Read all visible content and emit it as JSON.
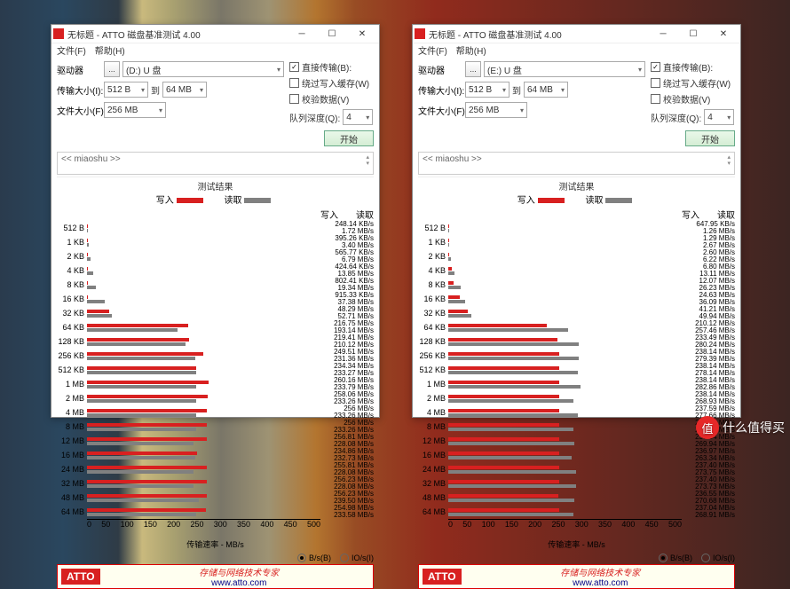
{
  "watermark": {
    "badge": "值",
    "text": "什么值得买"
  },
  "labels": {
    "title": "无标题 - ATTO 磁盘基准测试 4.00",
    "file_menu": "文件(F)",
    "help_menu": "帮助(H)",
    "drive": "驱动器",
    "xfer_size": "传输大小(I):",
    "file_size": "文件大小(F):",
    "direct": "直接传输(B):",
    "write_cache": "绕过写入缓存(W)",
    "verify": "校验数据(V)",
    "queue": "队列深度(Q):",
    "start": "开始",
    "desc_prefix": "<< miaoshu >>",
    "result_title": "测试结果",
    "write": "写入",
    "read": "读取",
    "xaxis_label": "传输速率 - MB/s",
    "bytes_per_sec": "B/s(B)",
    "io_per_sec": "IO/s(I)",
    "footer_text": "存储与网络技术专家",
    "footer_url": "www.atto.com",
    "atto": "ATTO",
    "to": "到"
  },
  "windows": [
    {
      "drive": "(D:) U 盘",
      "xfer_from": "512 B",
      "xfer_to": "64 MB",
      "file_size": "256 MB",
      "queue": "4",
      "chart_data": {
        "type": "bar",
        "xlabel": "传输速率 - MB/s",
        "xlim": [
          0,
          500
        ],
        "xticks": [
          0,
          50,
          100,
          150,
          200,
          250,
          300,
          350,
          400,
          450,
          500
        ],
        "categories": [
          "512 B",
          "1 KB",
          "2 KB",
          "4 KB",
          "8 KB",
          "16 KB",
          "32 KB",
          "64 KB",
          "128 KB",
          "256 KB",
          "512 KB",
          "1 MB",
          "2 MB",
          "4 MB",
          "8 MB",
          "12 MB",
          "16 MB",
          "24 MB",
          "32 MB",
          "48 MB",
          "64 MB"
        ],
        "series": [
          {
            "name": "写入",
            "unit": "KB/s|MB/s",
            "values": [
              248.14,
              395.26,
              565.77,
              424.64,
              802.41,
              915.33,
              48.29,
              216.75,
              219.41,
              249.51,
              234.34,
              260.16,
              258.06,
              256,
              256,
              256.81,
              234.86,
              255.81,
              256.23,
              256.23,
              254.98
            ],
            "display": [
              "248.14 KB/s",
              "395.26 KB/s",
              "565.77 KB/s",
              "424.64 KB/s",
              "802.41 KB/s",
              "915.33 KB/s",
              "48.29 MB/s",
              "216.75 MB/s",
              "219.41 MB/s",
              "249.51 MB/s",
              "234.34 MB/s",
              "260.16 MB/s",
              "258.06 MB/s",
              "256 MB/s",
              "256 MB/s",
              "256.81 MB/s",
              "234.86 MB/s",
              "255.81 MB/s",
              "256.23 MB/s",
              "256.23 MB/s",
              "254.98 MB/s"
            ],
            "mb": [
              0.24,
              0.39,
              0.55,
              0.41,
              0.78,
              0.89,
              48.29,
              216.75,
              219.41,
              249.51,
              234.34,
              260.16,
              258.06,
              256,
              256,
              256.81,
              234.86,
              255.81,
              256.23,
              256.23,
              254.98
            ]
          },
          {
            "name": "读取",
            "unit": "MB/s",
            "values": [
              1.72,
              3.4,
              6.79,
              13.85,
              19.34,
              37.38,
              52.71,
              193.14,
              210.12,
              231.36,
              233.27,
              233.79,
              233.26,
              233.26,
              233.26,
              228.08,
              232.73,
              228.08,
              228.08,
              239.5,
              233.58
            ],
            "display": [
              "1.72 MB/s",
              "3.40 MB/s",
              "6.79 MB/s",
              "13.85 MB/s",
              "19.34 MB/s",
              "37.38 MB/s",
              "52.71 MB/s",
              "193.14 MB/s",
              "210.12 MB/s",
              "231.36 MB/s",
              "233.27 MB/s",
              "233.79 MB/s",
              "233.26 MB/s",
              "233.26 MB/s",
              "233.26 MB/s",
              "228.08 MB/s",
              "232.73 MB/s",
              "228.08 MB/s",
              "228.08 MB/s",
              "239.50 MB/s",
              "233.58 MB/s"
            ],
            "mb": [
              1.72,
              3.4,
              6.79,
              13.85,
              19.34,
              37.38,
              52.71,
              193.14,
              210.12,
              231.36,
              233.27,
              233.79,
              233.26,
              233.26,
              233.26,
              228.08,
              232.73,
              228.08,
              228.08,
              239.5,
              233.58
            ]
          }
        ]
      }
    },
    {
      "drive": "(E:) U 盘",
      "xfer_from": "512 B",
      "xfer_to": "64 MB",
      "file_size": "256 MB",
      "queue": "4",
      "chart_data": {
        "type": "bar",
        "xlabel": "传输速率 - MB/s",
        "xlim": [
          0,
          500
        ],
        "xticks": [
          0,
          50,
          100,
          150,
          200,
          250,
          300,
          350,
          400,
          450,
          500
        ],
        "categories": [
          "512 B",
          "1 KB",
          "2 KB",
          "4 KB",
          "8 KB",
          "16 KB",
          "32 KB",
          "64 KB",
          "128 KB",
          "256 KB",
          "512 KB",
          "1 MB",
          "2 MB",
          "4 MB",
          "8 MB",
          "12 MB",
          "16 MB",
          "24 MB",
          "32 MB",
          "48 MB",
          "64 MB"
        ],
        "series": [
          {
            "name": "写入",
            "mb": [
              0.63,
              1.29,
              2.6,
              6.8,
              12.07,
              24.63,
              41.21,
              210.12,
              233.49,
              238.14,
              238.14,
              238.14,
              238.14,
              237.59,
              237.59,
              237.84,
              236.97,
              237.4,
              237.4,
              236.55,
              237.04
            ],
            "display": [
              "647.95 KB/s",
              "1.29 MB/s",
              "2.60 MB/s",
              "6.80 MB/s",
              "12.07 MB/s",
              "24.63 MB/s",
              "41.21 MB/s",
              "210.12 MB/s",
              "233.49 MB/s",
              "238.14 MB/s",
              "238.14 MB/s",
              "238.14 MB/s",
              "238.14 MB/s",
              "237.59 MB/s",
              "237.59 MB/s",
              "237.84 MB/s",
              "236.97 MB/s",
              "237.40 MB/s",
              "237.40 MB/s",
              "236.55 MB/s",
              "237.04 MB/s"
            ]
          },
          {
            "name": "读取",
            "mb": [
              1.26,
              2.67,
              6.22,
              13.11,
              26.23,
              36.09,
              49.94,
              257.46,
              280.24,
              279.39,
              278.14,
              282.86,
              268.93,
              277.66,
              268.93,
              269.94,
              263.34,
              273.75,
              273.73,
              270.68,
              268.91
            ],
            "display": [
              "1.26 MB/s",
              "2.67 MB/s",
              "6.22 MB/s",
              "13.11 MB/s",
              "26.23 MB/s",
              "36.09 MB/s",
              "49.94 MB/s",
              "257.46 MB/s",
              "280.24 MB/s",
              "279.39 MB/s",
              "278.14 MB/s",
              "282.86 MB/s",
              "268.93 MB/s",
              "277.66 MB/s",
              "268.93 MB/s",
              "269.94 MB/s",
              "263.34 MB/s",
              "273.75 MB/s",
              "273.73 MB/s",
              "270.68 MB/s",
              "268.91 MB/s"
            ]
          }
        ]
      }
    }
  ]
}
